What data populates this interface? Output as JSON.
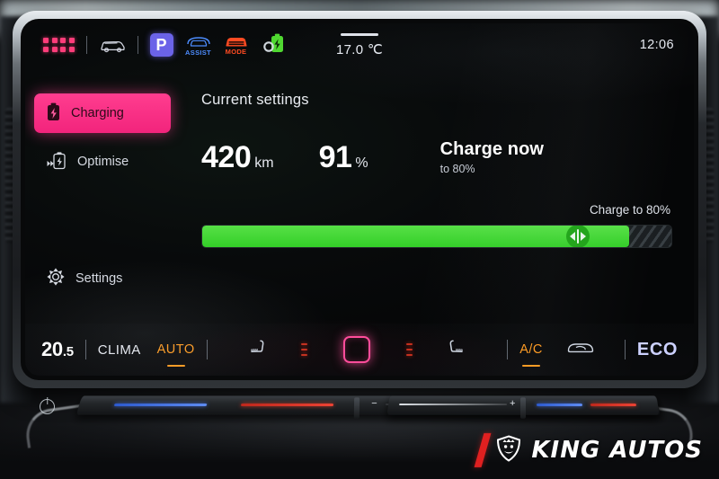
{
  "status_bar": {
    "icons": [
      {
        "name": "apps-grid-icon",
        "label": ""
      },
      {
        "name": "vehicle-icon",
        "label": ""
      },
      {
        "name": "park-assist-p-icon",
        "label": "P"
      },
      {
        "name": "assist-icon",
        "label": "ASSIST"
      },
      {
        "name": "drive-mode-icon",
        "label": "MODE"
      },
      {
        "name": "battery-charging-settings-icon",
        "label": ""
      }
    ],
    "temperature": "17.0 ℃",
    "clock": "12:06"
  },
  "sidebar": {
    "items": [
      {
        "label": "Charging",
        "icon": "battery-icon",
        "active": true
      },
      {
        "label": "Optimise",
        "icon": "battery-fast-icon",
        "active": false
      }
    ],
    "bottom_item": {
      "label": "Settings",
      "icon": "gear-icon",
      "active": false
    }
  },
  "main": {
    "title": "Current settings",
    "range_value": "420",
    "range_unit": "km",
    "soc_value": "91",
    "soc_unit": "%",
    "charge_now_title": "Charge now",
    "charge_now_sub": "to 80%",
    "slider_label": "Charge to 80%",
    "slider_percent": 80,
    "slider_hatch_start_percent": 91
  },
  "climate_bar": {
    "temp_whole": "20",
    "temp_decimal": ".5",
    "clima_label": "CLIMA",
    "auto_label": "AUTO",
    "ac_label": "A/C",
    "eco_label": "ECO",
    "seat_left_icon": "seat-heater-left-icon",
    "seat_right_icon": "seat-heater-right-icon",
    "center_icon": "fan-center-icon",
    "defrost_icon": "windshield-defrost-icon"
  },
  "watermark": {
    "text": "KING AUTOS",
    "emblem": "crowned-lion-shield-icon"
  },
  "colors": {
    "accent_pink": "#ff3d8f",
    "charge_green": "#3ad42e",
    "amber": "#ff9a1f",
    "assist_blue": "#4d8dff",
    "mode_orange": "#ff4b22",
    "park_purple": "#6b63e8",
    "eco_lavender": "#ccd1ff",
    "watermark_red": "#e02020"
  }
}
